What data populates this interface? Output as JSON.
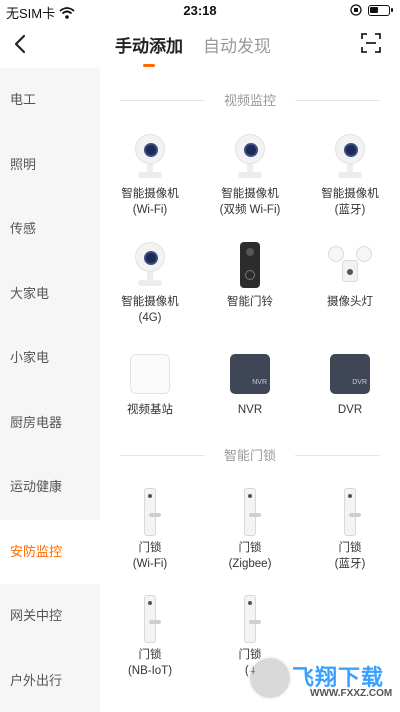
{
  "status": {
    "carrier": "无SIM卡",
    "time": "23:18",
    "wifi_icon": "wifi-icon",
    "battery_icon": "battery-icon"
  },
  "header": {
    "back_icon": "chevron-left-icon",
    "tabs": [
      {
        "label": "手动添加",
        "active": true
      },
      {
        "label": "自动发现",
        "active": false
      }
    ],
    "scan_icon": "scan-icon",
    "accent_color": "#ff6a00"
  },
  "sidebar": {
    "items": [
      {
        "label": "电工"
      },
      {
        "label": "照明"
      },
      {
        "label": "传感"
      },
      {
        "label": "大家电"
      },
      {
        "label": "小家电"
      },
      {
        "label": "厨房电器"
      },
      {
        "label": "运动健康"
      },
      {
        "label": "安防监控",
        "active": true
      },
      {
        "label": "网关中控"
      },
      {
        "label": "户外出行"
      }
    ]
  },
  "sections": [
    {
      "title": "视频监控",
      "devices": [
        {
          "line1": "智能摄像机",
          "line2": "(Wi-Fi)",
          "icon": "camera-icon"
        },
        {
          "line1": "智能摄像机",
          "line2": "(双频 Wi-Fi)",
          "icon": "camera-icon"
        },
        {
          "line1": "智能摄像机",
          "line2": "(蓝牙)",
          "icon": "camera-icon"
        },
        {
          "line1": "智能摄像机",
          "line2": "(4G)",
          "icon": "camera-icon"
        },
        {
          "line1": "智能门铃",
          "line2": "",
          "icon": "doorbell-icon"
        },
        {
          "line1": "摄像头灯",
          "line2": "",
          "icon": "floodlight-camera-icon"
        },
        {
          "line1": "视频基站",
          "line2": "",
          "icon": "base-station-icon"
        },
        {
          "line1": "NVR",
          "line2": "",
          "icon": "nvr-icon",
          "badge": "NVR"
        },
        {
          "line1": "DVR",
          "line2": "",
          "icon": "dvr-icon",
          "badge": "DVR"
        }
      ]
    },
    {
      "title": "智能门锁",
      "devices": [
        {
          "line1": "门锁",
          "line2": "(Wi-Fi)",
          "icon": "door-lock-icon"
        },
        {
          "line1": "门锁",
          "line2": "(Zigbee)",
          "icon": "door-lock-icon"
        },
        {
          "line1": "门锁",
          "line2": "(蓝牙)",
          "icon": "door-lock-icon"
        },
        {
          "line1": "门锁",
          "line2": "(NB-IoT)",
          "icon": "door-lock-icon"
        },
        {
          "line1": "门锁",
          "line2": "(4",
          "icon": "door-lock-icon"
        }
      ]
    }
  ],
  "watermark": {
    "text": "飞翔下载",
    "sub": "WWW.FXXZ.COM"
  }
}
